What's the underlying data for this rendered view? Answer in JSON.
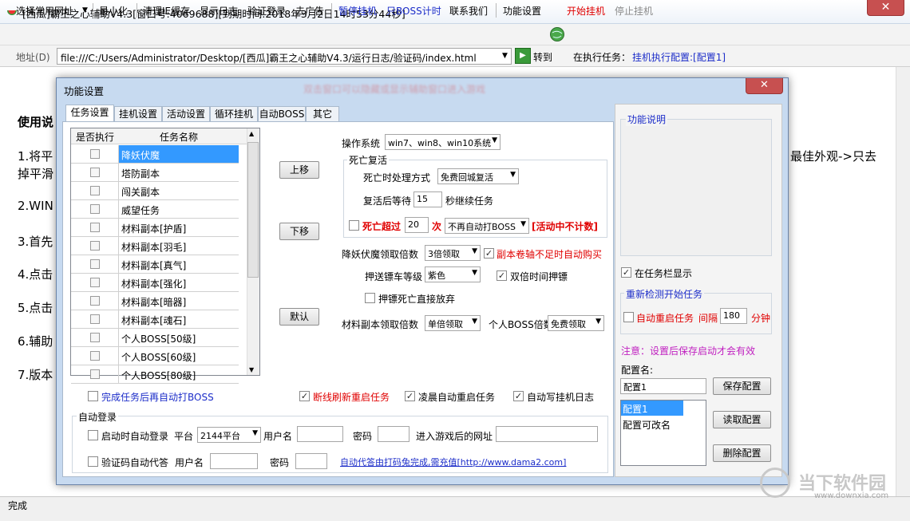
{
  "window": {
    "title": "[西瓜]霸王之心辅助V4.3[窗口号:4069688][到期时间:2018年3月2日14时53分44秒]",
    "close": "✕"
  },
  "toolbar": {
    "favorites": "选择常用网址",
    "minimize": "最小化",
    "clear_ie": "清理IE缓存",
    "show_log": "显示日志",
    "verify_login": "验证登录",
    "remove_ads": "去广告",
    "pause": "暂停挂机",
    "boss_timer": "只BOSS计时",
    "contact": "联系我们",
    "settings": "功能设置",
    "start": "开始挂机",
    "stop": "停止挂机"
  },
  "address": {
    "label": "地址(D)",
    "value": "file:///C:/Users/Administrator/Desktop/[西瓜]霸王之心辅助V4.3/运行日志/验证码/index.html",
    "go": "转到",
    "task_label": "在执行任务：",
    "task_value": "挂机执行配置:[配置1]"
  },
  "content": {
    "heading": "使用说",
    "line1a": "1.将平",
    "line1b": "掉平滑",
    "line1c": "最佳外观->只去",
    "line2": "2.WIN",
    "line3": "3.首先",
    "line4": "4.点击",
    "line5": "5.点击",
    "line6": "6.辅助",
    "line7": "7.版本"
  },
  "status": "完成",
  "dialog": {
    "title": "功能设置",
    "banner": "双击窗口可以隐藏或显示辅助窗口进入游戏",
    "close": "✕",
    "tabs": [
      "任务设置",
      "挂机设置",
      "活动设置",
      "循环挂机",
      "自动BOSS",
      "其它"
    ],
    "list": {
      "col_exec": "是否执行",
      "col_name": "任务名称",
      "items": [
        "降妖伏魔",
        "塔防副本",
        "闯关副本",
        "威望任务",
        "材料副本[护盾]",
        "材料副本[羽毛]",
        "材料副本[真气]",
        "材料副本[强化]",
        "材料副本[暗器]",
        "材料副本[魂石]",
        "个人BOSS[50级]",
        "个人BOSS[60级]",
        "个人BOSS[80级]"
      ]
    },
    "buttons": {
      "up": "上移",
      "down": "下移",
      "default": "默认"
    },
    "os_label": "操作系统",
    "os_value": "win7、win8、win10系统",
    "death_group": "死亡复活",
    "death_mode_label": "死亡时处理方式",
    "death_mode_value": "免费回城复活",
    "wait_label": "复活后等待",
    "wait_value": "15",
    "wait_unit": "秒继续任务",
    "death_exceed_label": "死亡超过",
    "death_exceed_value": "20",
    "death_exceed_unit": "次",
    "death_exceed_action": "不再自动打BOSS",
    "death_exceed_note": "[活动中不计数]",
    "demon_mult_label": "降妖伏魔领取倍数",
    "demon_mult_value": "3倍领取",
    "auto_buy_scroll": "副本卷轴不足时自动购买",
    "escort_label": "押送镖车等级",
    "escort_value": "紫色",
    "double_escort": "双倍时间押镖",
    "escort_death_giveup": "押镖死亡直接放弃",
    "material_mult_label": "材料副本领取倍数",
    "material_mult_value": "单倍领取",
    "boss_mult_label": "个人BOSS倍数",
    "boss_mult_value": "免费领取",
    "after_task_boss": "完成任务后再自动打BOSS",
    "reconnect_restart": "断线刷新重启任务",
    "dawn_restart": "凌晨自动重启任务",
    "auto_log": "自动写挂机日志",
    "autologin": {
      "group": "自动登录",
      "on_start": "启动时自动登录",
      "platform_label": "平台",
      "platform_value": "2144平台",
      "user_label": "用户名",
      "pass_label": "密码",
      "url_label": "进入游戏后的网址",
      "captcha_auto": "验证码自动代答",
      "user_label2": "用户名",
      "pass_label2": "密码",
      "captcha_link": "自动代答由打码兔完成,需充值[http://www.dama2.com]"
    },
    "right": {
      "func_desc": "功能说明",
      "show_taskbar": "在任务栏显示",
      "recheck_title": "重新检测开始任务",
      "auto_restart": "自动重启任务",
      "interval_label": "间隔",
      "interval_value": "180",
      "interval_unit": "分钟",
      "note": "注意：设置后保存启动才会有效",
      "config_name_label": "配置名:",
      "config_name_value": "配置1",
      "save": "保存配置",
      "read": "读取配置",
      "delete": "删除配置",
      "configs": [
        "配置1",
        "配置可改名"
      ]
    }
  },
  "watermark": {
    "text": "当下软件园",
    "url": "www.downxia.com"
  },
  "colors": {
    "accent_blue": "#1c2dc9",
    "warning_red": "#e00000",
    "selection": "#3399ff",
    "dialog_frame": "#c7daf0"
  }
}
